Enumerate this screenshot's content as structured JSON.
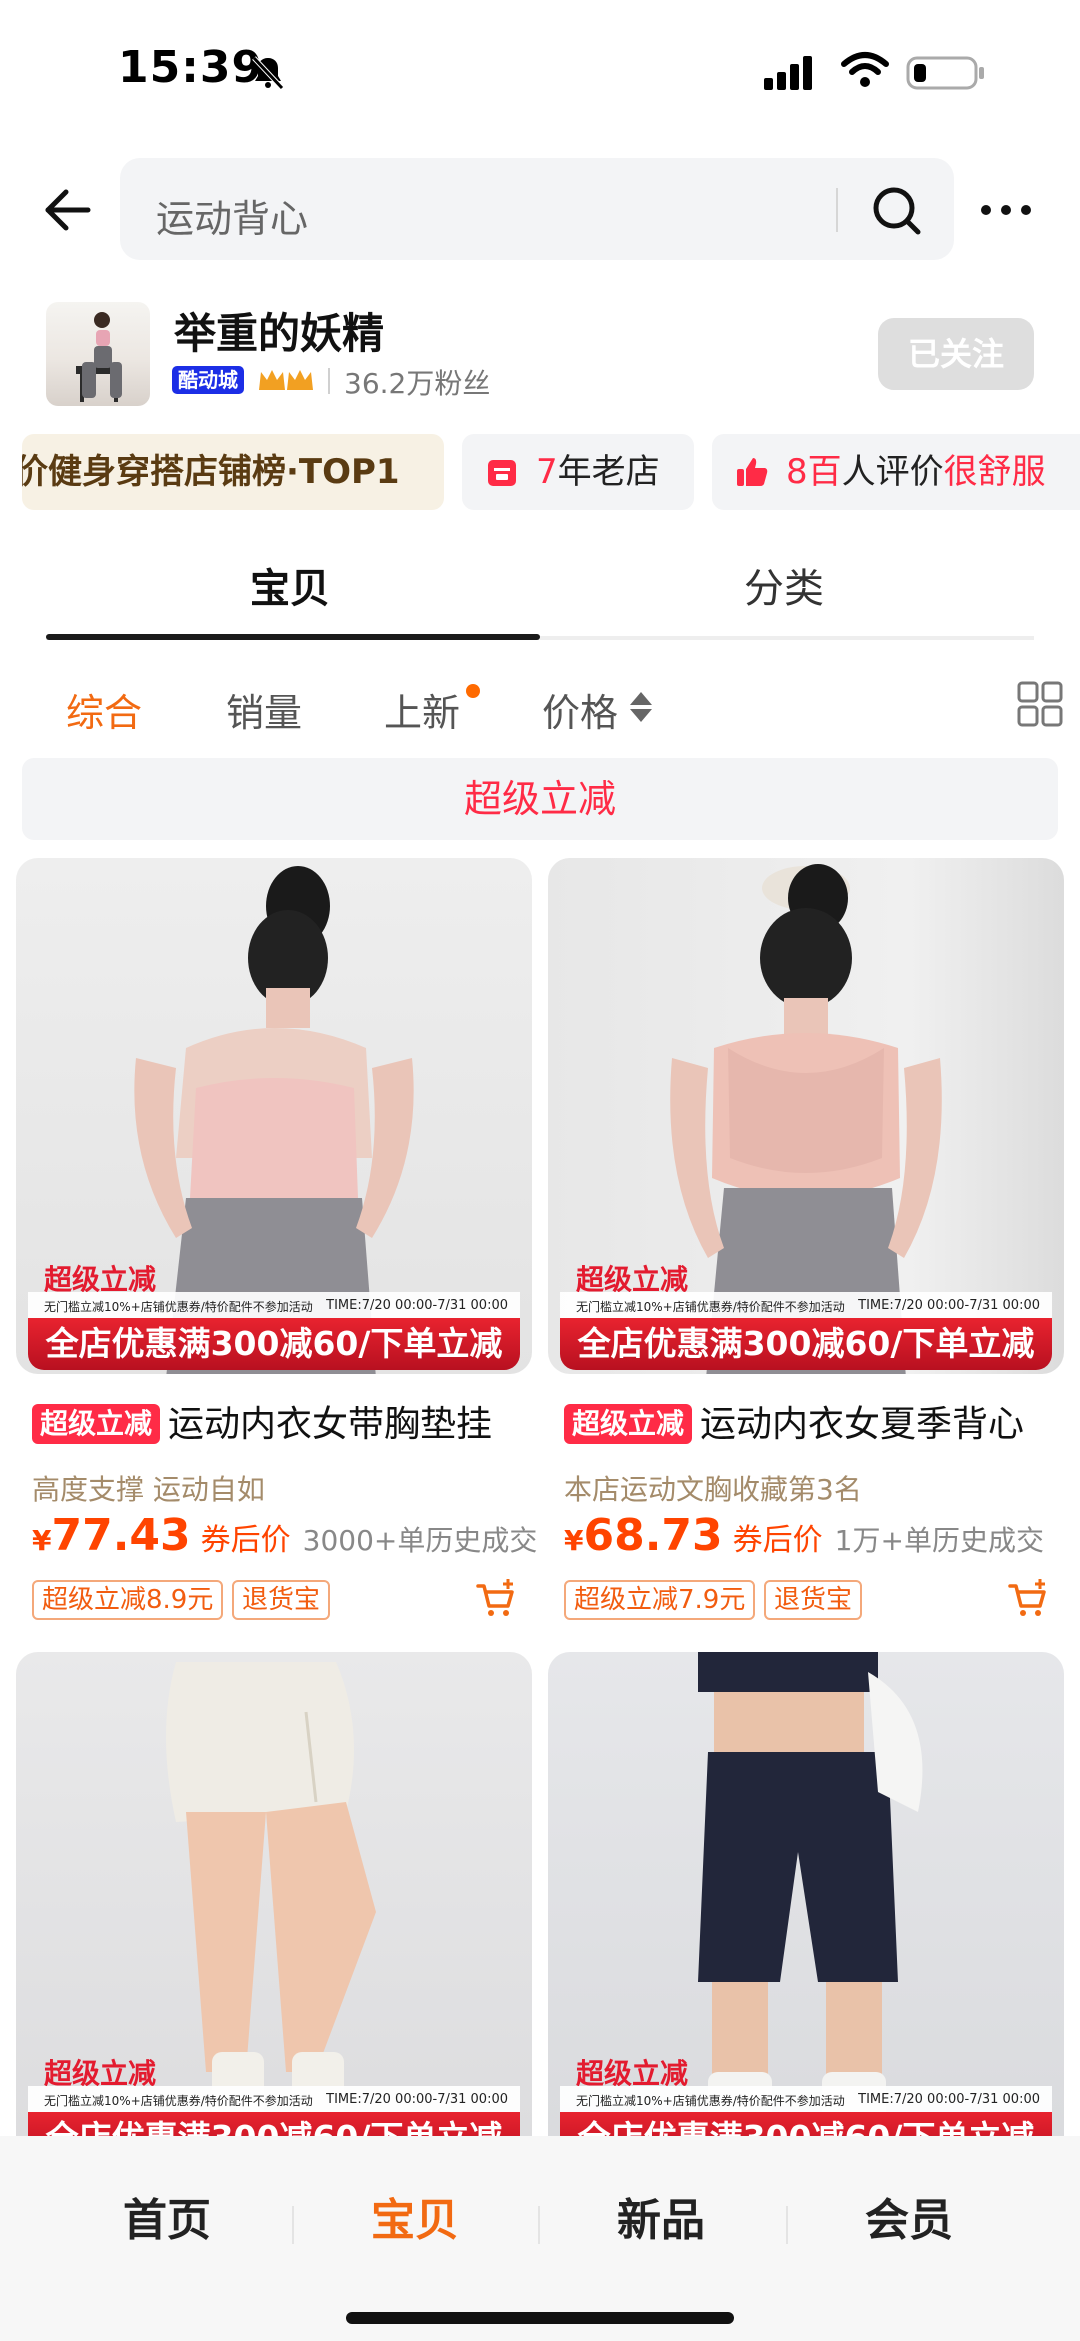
{
  "status_bar": {
    "time": "15:39"
  },
  "search": {
    "query": "运动背心"
  },
  "shop": {
    "name": "举重的妖精",
    "tag": "酷动城",
    "fans": "36.2万粉丝",
    "follow_label": "已关注"
  },
  "badges": {
    "rank": "价健身穿搭店铺榜·TOP1",
    "years_num": "7",
    "years_text": "年老店",
    "reviews_num": "8百",
    "reviews_text": "人评价",
    "reviews_extra": "很舒服"
  },
  "tabs": [
    {
      "label": "宝贝",
      "active": true
    },
    {
      "label": "分类",
      "active": false
    }
  ],
  "sort": [
    "综合",
    "销量",
    "上新",
    "价格"
  ],
  "promo_banner": "超级立减",
  "product_strip": {
    "label": "超级立减",
    "small": "无门槛立减10%+店铺优惠券/特价配件不参加活动",
    "time": "TIME:7/20 00:00-7/31 00:00",
    "main": "全店优惠满300减60/下单立减"
  },
  "products": [
    {
      "tag": "超级立减",
      "title": "运动内衣女带胸垫挂",
      "subtitle": "高度支撑 运动自如",
      "currency": "¥",
      "price": "77.43",
      "after_label": "券后价",
      "sold": "3000+单历史成交",
      "chips": [
        "超级立减8.9元",
        "退货宝"
      ]
    },
    {
      "tag": "超级立减",
      "title": "运动内衣女夏季背心",
      "subtitle": "本店运动文胸收藏第3名",
      "currency": "¥",
      "price": "68.73",
      "after_label": "券后价",
      "sold": "1万+单历史成交",
      "chips": [
        "超级立减7.9元",
        "退货宝"
      ]
    }
  ],
  "bottom_nav": [
    {
      "label": "首页",
      "active": false
    },
    {
      "label": "宝贝",
      "active": true
    },
    {
      "label": "新品",
      "active": false
    },
    {
      "label": "会员",
      "active": false
    }
  ],
  "colors": {
    "accent": "#f26a12",
    "promo_red": "#ff2b46",
    "price": "#ff4400"
  }
}
